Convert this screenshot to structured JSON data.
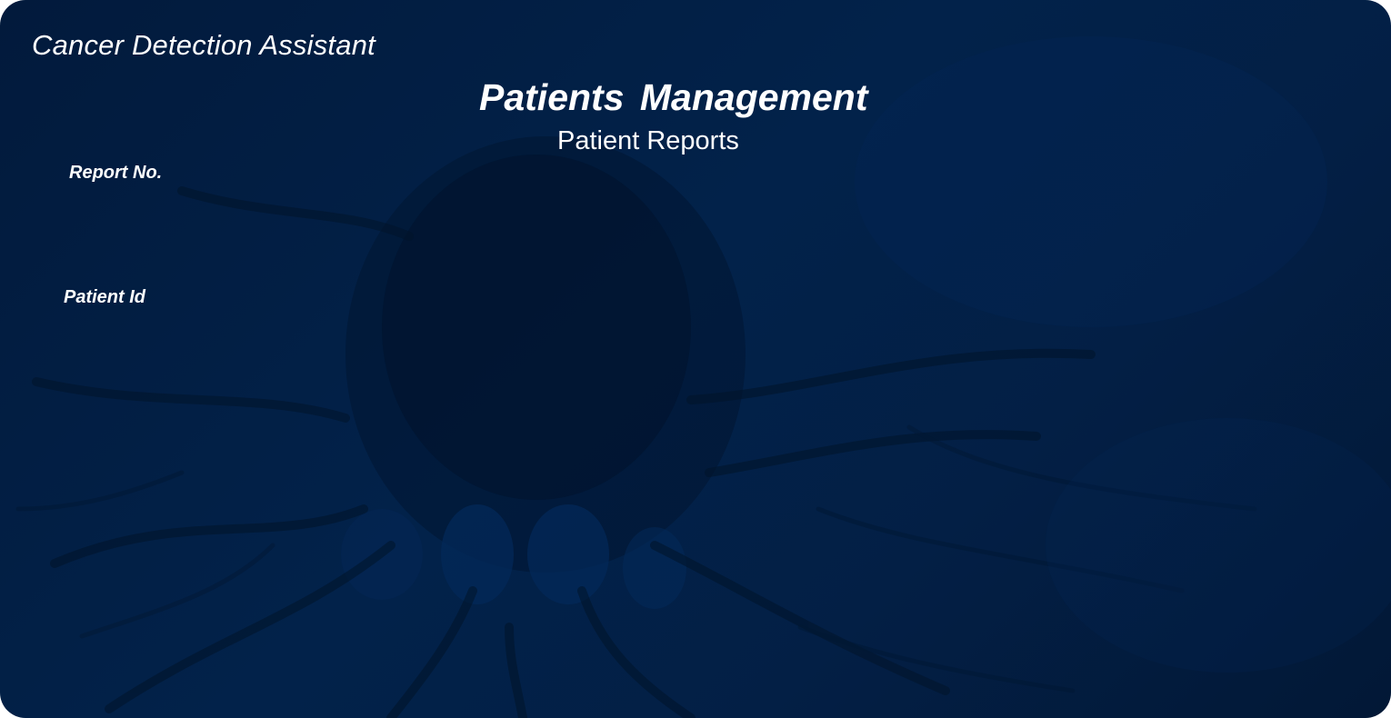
{
  "app": {
    "title": "Cancer Detection Assistant"
  },
  "header": {
    "title": "Patients  Management",
    "subtitle": "Patient Reports"
  },
  "form": {
    "report_no_label": "Report No.",
    "patient_id_label": "Patient Id"
  },
  "colors": {
    "background": "#02224a",
    "text": "#ffffff"
  },
  "background_image": "cancer-cell-illustration"
}
